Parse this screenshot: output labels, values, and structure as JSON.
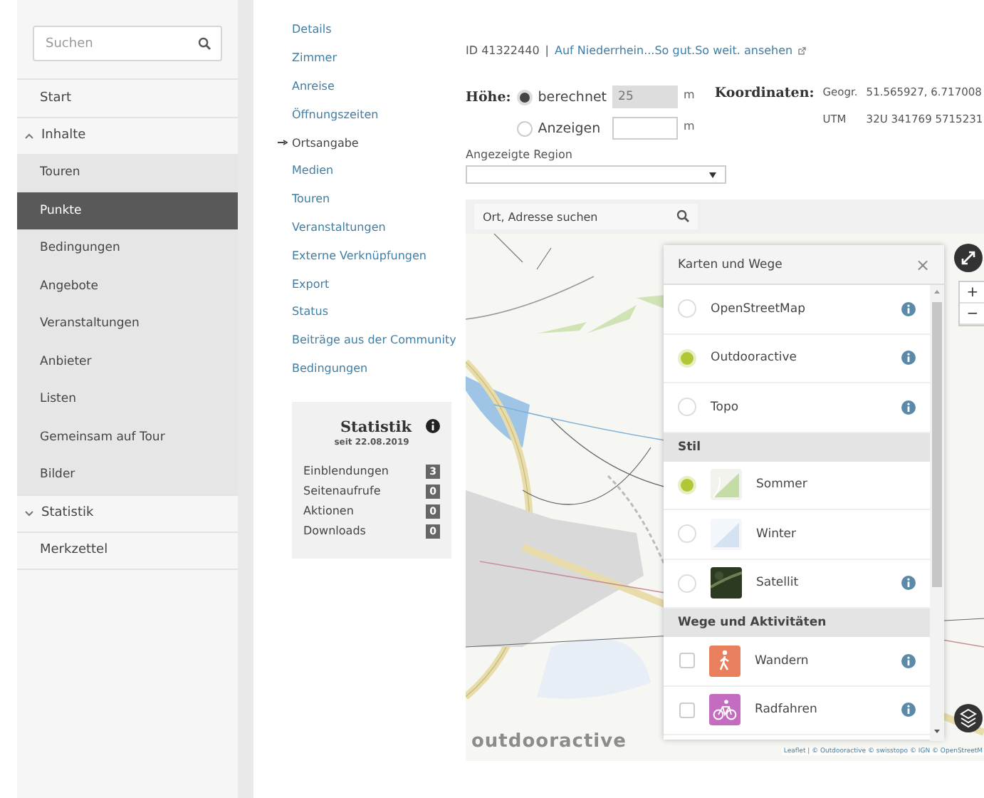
{
  "sidebar": {
    "search": {
      "placeholder": "Suchen"
    },
    "items": [
      {
        "label": "Start",
        "kind": "link",
        "selected": false
      },
      {
        "label": "Inhalte",
        "kind": "group",
        "expanded": true,
        "children": [
          {
            "label": "Touren",
            "selected": false
          },
          {
            "label": "Punkte",
            "selected": true
          },
          {
            "label": "Bedingungen",
            "selected": false
          },
          {
            "label": "Angebote",
            "selected": false
          },
          {
            "label": "Veranstaltungen",
            "selected": false
          },
          {
            "label": "Anbieter",
            "selected": false
          },
          {
            "label": "Listen",
            "selected": false
          },
          {
            "label": "Gemeinsam auf Tour",
            "selected": false
          },
          {
            "label": "Bilder",
            "selected": false
          }
        ]
      },
      {
        "label": "Statistik",
        "kind": "group",
        "expanded": false
      },
      {
        "label": "Merkzettel",
        "kind": "link",
        "selected": false
      }
    ]
  },
  "subnav": {
    "items": [
      {
        "label": "Details",
        "selected": false
      },
      {
        "label": "Zimmer",
        "selected": false
      },
      {
        "label": "Anreise",
        "selected": false
      },
      {
        "label": "Öffnungszeiten",
        "selected": false
      },
      {
        "label": "Ortsangabe",
        "selected": true
      },
      {
        "label": "Medien",
        "selected": false
      },
      {
        "label": "Touren",
        "selected": false
      },
      {
        "label": "Veranstaltungen",
        "selected": false
      },
      {
        "label": "Externe Verknüpfungen",
        "selected": false
      },
      {
        "label": "Export",
        "selected": false
      },
      {
        "label": "Status",
        "selected": false
      },
      {
        "label": "Beiträge aus der Community",
        "selected": false
      },
      {
        "label": "Bedingungen",
        "selected": false
      }
    ],
    "stats": {
      "title": "Statistik",
      "subtitle": "seit 22.08.2019",
      "rows": [
        {
          "label": "Einblendungen",
          "count": "3"
        },
        {
          "label": "Seitenaufrufe",
          "count": "0"
        },
        {
          "label": "Aktionen",
          "count": "0"
        },
        {
          "label": "Downloads",
          "count": "0"
        }
      ]
    }
  },
  "main": {
    "id_line": {
      "id": "ID 41322440",
      "separator": "|",
      "link": "Auf Niederrhein...So gut.So weit. ansehen"
    },
    "height": {
      "label": "Höhe:",
      "options": [
        {
          "label": "berechnet",
          "selected": true,
          "value": "25",
          "disabled": true,
          "unit": "m"
        },
        {
          "label": "Anzeigen",
          "selected": false,
          "disabled": false,
          "unit": "m"
        }
      ]
    },
    "coordinates": {
      "label": "Koordinaten:",
      "rows": [
        {
          "system": "Geogr.",
          "value": "51.565927, 6.717008"
        },
        {
          "system": "UTM",
          "value": "32U 341769 5715231"
        }
      ]
    },
    "region": {
      "label": "Angezeigte Region"
    },
    "map": {
      "search": {
        "placeholder": "Ort, Adresse suchen"
      },
      "zoom": [
        "+",
        "−"
      ],
      "logo": "outdooractive",
      "attribution": "Leaflet | © Outdooractive © swisstopo © IGN © OpenStreetM",
      "layers": {
        "title": "Karten und Wege",
        "close": "×",
        "sections": [
          {
            "items": [
              {
                "label": "OpenStreetMap",
                "kind": "map",
                "selected": false,
                "info": true
              },
              {
                "label": "Outdooractive",
                "kind": "map",
                "selected": true,
                "info": true
              },
              {
                "label": "Topo",
                "kind": "map",
                "selected": false,
                "info": true
              }
            ]
          },
          {
            "title": "Stil",
            "items": [
              {
                "label": "Sommer",
                "kind": "summer",
                "selected": true,
                "info": false
              },
              {
                "label": "Winter",
                "kind": "winter",
                "selected": false,
                "info": false
              },
              {
                "label": "Satellit",
                "kind": "satellite",
                "selected": false,
                "info": true
              }
            ]
          },
          {
            "title": "Wege und Aktivitäten",
            "items": [
              {
                "label": "Wandern",
                "kind": "hiking",
                "color": "#e8805e",
                "checked": false,
                "info": true
              },
              {
                "label": "Radfahren",
                "kind": "cycling",
                "color": "#c46cc0",
                "checked": false,
                "info": true
              }
            ]
          }
        ]
      }
    }
  }
}
